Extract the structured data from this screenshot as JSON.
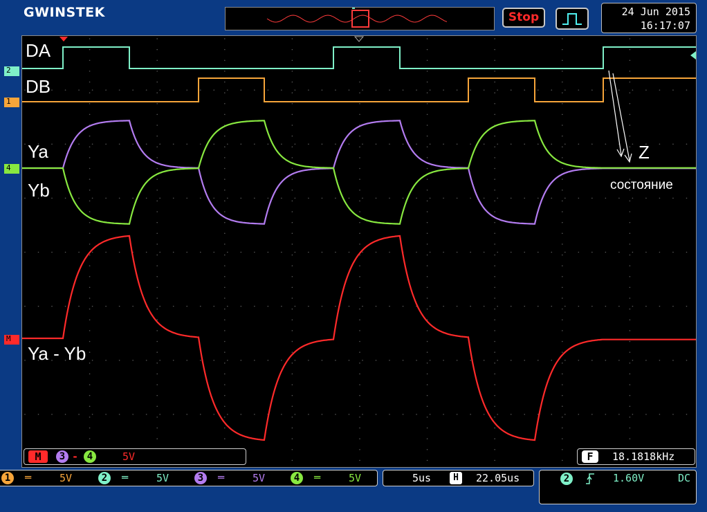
{
  "header": {
    "logo": "GWINSTEK",
    "run_state": "Stop",
    "date": "24 Jun 2015",
    "time": "16:17:07"
  },
  "waveform_labels": {
    "da": "DA",
    "db": "DB",
    "ya": "Ya",
    "yb": "Yb",
    "z": "Z",
    "state": "состояние",
    "diff": "Ya - Yb"
  },
  "channel_markers": {
    "ch2": "2",
    "ch1": "1",
    "ch4": "4",
    "math": "M"
  },
  "math": {
    "badge": "M",
    "src_a": "3",
    "op": "-",
    "src_b": "4",
    "scale": "5V"
  },
  "frequency": {
    "icon": "F",
    "value": "18.1818kHz"
  },
  "channels": [
    {
      "num": "1",
      "coupling": "DC",
      "scale": "5V",
      "color": "#f7a53a"
    },
    {
      "num": "2",
      "coupling": "DC",
      "scale": "5V",
      "color": "#7ff0c8"
    },
    {
      "num": "3",
      "coupling": "DC",
      "scale": "5V",
      "color": "#b37cf0"
    },
    {
      "num": "4",
      "coupling": "DC",
      "scale": "5V",
      "color": "#88e840"
    }
  ],
  "timebase": {
    "scale": "5us",
    "h_icon": "H",
    "position": "22.05us"
  },
  "trigger": {
    "source": "2",
    "slope": "rising-edge-icon",
    "level": "1.60V",
    "coupling": "DC"
  },
  "colors": {
    "background": "#0b3a84",
    "ch1_orange": "#f7a53a",
    "ch2_cyan": "#7ff0c8",
    "ch3_purple": "#b37cf0",
    "ch4_green": "#88e840",
    "math_red": "#ff2a2a"
  }
}
